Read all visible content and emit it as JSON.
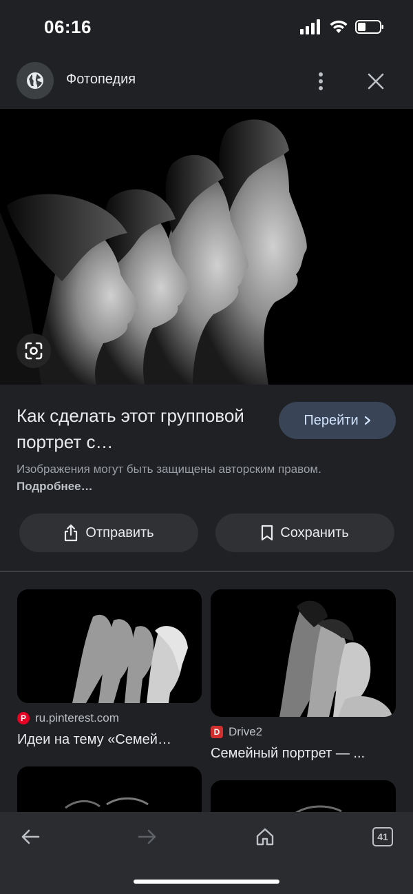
{
  "status_bar": {
    "time": "06:16"
  },
  "header": {
    "site_name": "Фотопедия"
  },
  "result": {
    "title": "Как сделать этот групповой портрет с…",
    "go_button": "Перейти",
    "copyright_text": "Изображения могут быть защищены авторским правом.",
    "more_link": "Подробнее…",
    "share_button": "Отправить",
    "save_button": "Сохранить"
  },
  "related": [
    {
      "source": "ru.pinterest.com",
      "caption": "Идеи на тему «Семей…",
      "favicon_color": "#e60023",
      "favicon_letter": "P"
    },
    {
      "source": "Drive2",
      "caption": "Семейный портрет — ...",
      "favicon_color": "#d32f2f",
      "favicon_letter": "D"
    }
  ],
  "bottom_nav": {
    "tab_count": "41"
  },
  "colors": {
    "background": "#202124",
    "accent_button": "#394457",
    "bottom_bar": "#2b2c2f"
  }
}
